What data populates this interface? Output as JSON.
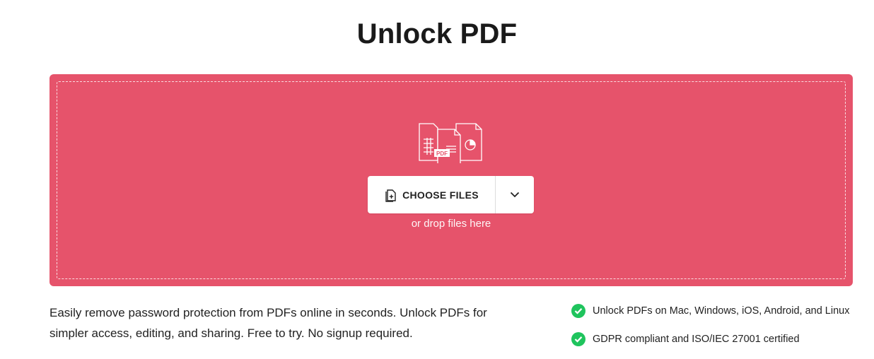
{
  "page_title": "Unlock PDF",
  "upload": {
    "illustration_icon": "files-pdf-illustration-icon",
    "illustration_badge": "PDF",
    "choose_label": "CHOOSE FILES",
    "choose_icon": "file-add-icon",
    "dropdown_icon": "chevron-down-icon",
    "drop_hint": "or drop files here"
  },
  "description": "Easily remove password protection from PDFs online in seconds. Unlock PDFs for simpler access, editing, and sharing. Free to try. No signup required.",
  "features": [
    {
      "icon": "check-circle-icon",
      "text": "Unlock PDFs on Mac, Windows, iOS, Android, and Linux"
    },
    {
      "icon": "check-circle-icon",
      "text": "GDPR compliant and ISO/IEC 27001 certified"
    }
  ],
  "colors": {
    "dropzone": "#e6536b",
    "check": "#1fc45d"
  }
}
